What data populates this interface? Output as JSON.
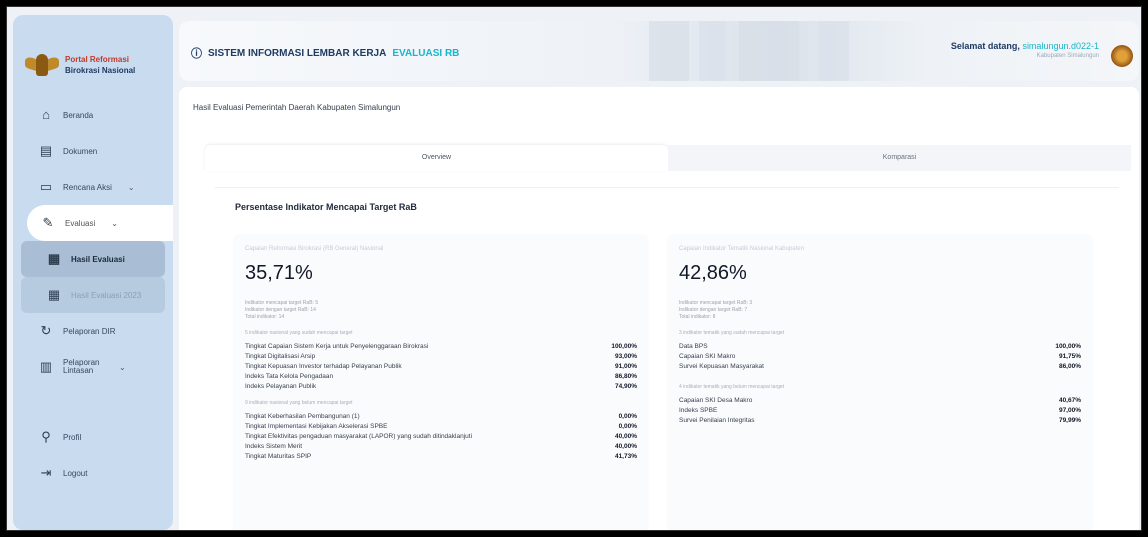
{
  "brand": {
    "line1": "Portal Reformasi",
    "line2": "Birokrasi Nasional"
  },
  "sidebar": {
    "items": [
      {
        "icon": "home-icon",
        "label": "Beranda"
      },
      {
        "icon": "document-icon",
        "label": "Dokumen"
      },
      {
        "icon": "folder-icon",
        "label": "Rencana Aksi"
      },
      {
        "icon": "edit-icon",
        "label": "Evaluasi"
      },
      {
        "icon": "chart-icon",
        "label": "Hasil Evaluasi"
      },
      {
        "icon": "chart-icon",
        "label": "Hasil Evaluasi 2023"
      },
      {
        "icon": "refresh-icon",
        "label": "Pelaporan DIR"
      },
      {
        "icon": "report-icon",
        "label": "Pelaporan Lintasan"
      },
      {
        "icon": "user-icon",
        "label": "Profil"
      },
      {
        "icon": "logout-icon",
        "label": "Logout"
      }
    ]
  },
  "header": {
    "title": "SISTEM INFORMASI LEMBAR KERJA",
    "title_accent": "EVALUASI RB",
    "welcome": "Selamat datang,",
    "username": "simalungun.d022-1",
    "subtitle": "Kabupaten Simalungun"
  },
  "page": {
    "title": "Hasil Evaluasi Pemerintah Daerah Kabupaten Simalungun",
    "tabs": [
      "Overview",
      "Komparasi"
    ],
    "card_title": "Persentase Indikator Mencapai Target RaB"
  },
  "left_panel": {
    "subtitle": "Capaian Reformasi Birokrasi (RB General) Nasional",
    "percent": "35,71%",
    "stats": [
      "Indikator mencapai target RaB: 5",
      "Indikator dengan target RaB: 14",
      "Total indikator: 14"
    ],
    "section1": "5 indikator nasional yang sudah mencapai target",
    "rows1": [
      {
        "label": "Tingkat Capaian Sistem Kerja untuk Penyelenggaraan Birokrasi",
        "value": "100,00%"
      },
      {
        "label": "Tingkat Digitalisasi Arsip",
        "value": "93,00%"
      },
      {
        "label": "Tingkat Kepuasan Investor terhadap Pelayanan Publik",
        "value": "91,00%"
      },
      {
        "label": "Indeks Tata Kelola Pengadaan",
        "value": "86,80%"
      },
      {
        "label": "Indeks Pelayanan Publik",
        "value": "74,90%"
      }
    ],
    "section2": "9 indikator nasional yang belum mencapai target",
    "rows2": [
      {
        "label": "Tingkat Keberhasilan Pembangunan (1)",
        "value": "0,00%"
      },
      {
        "label": "Tingkat Implementasi Kebijakan Akselerasi SPBE",
        "value": "0,00%"
      },
      {
        "label": "Tingkat Efektivitas pengaduan masyarakat (LAPOR) yang sudah ditindaklanjuti",
        "value": "40,00%"
      },
      {
        "label": "Indeks Sistem Merit",
        "value": "40,00%"
      },
      {
        "label": "Tingkat Maturitas SPIP",
        "value": "41,73%"
      }
    ]
  },
  "right_panel": {
    "subtitle": "Capaian Indikator Tematik Nasional Kabupaten",
    "percent": "42,86%",
    "stats": [
      "Indikator mencapai target RaB: 3",
      "Indikator dengan target RaB: 7",
      "Total indikator: 8"
    ],
    "section1": "3 indikator tematik yang sudah mencapai target",
    "rows1": [
      {
        "label": "Data BPS",
        "value": "100,00%"
      },
      {
        "label": "Capaian SKI Makro",
        "value": "91,75%"
      },
      {
        "label": "Survei Kepuasan Masyarakat",
        "value": "86,00%"
      }
    ],
    "section2": "4 indikator tematik yang belum mencapai target",
    "rows2": [
      {
        "label": "Capaian SKI Desa Makro",
        "value": "40,67%"
      },
      {
        "label": "Indeks SPBE",
        "value": "97,00%"
      },
      {
        "label": "Survei Penilaian Integritas",
        "value": "79,99%"
      }
    ]
  }
}
